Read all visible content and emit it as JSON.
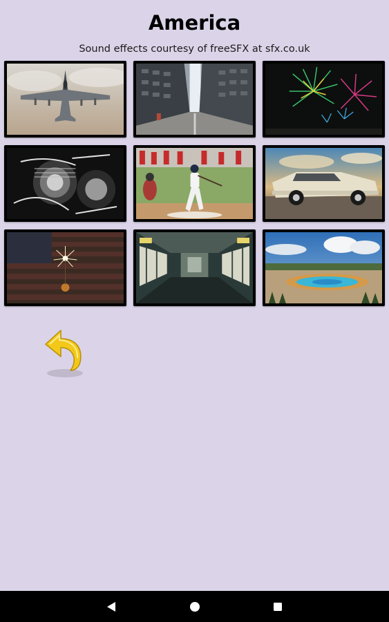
{
  "header": {
    "title": "America",
    "subtitle": "Sound effects courtesy of freeSFX at sfx.co.uk"
  },
  "tiles": [
    {
      "icon": "fighter-jet-image"
    },
    {
      "icon": "city-street-image"
    },
    {
      "icon": "fireworks-image"
    },
    {
      "icon": "motorcycle-engine-image"
    },
    {
      "icon": "baseball-batter-image"
    },
    {
      "icon": "classic-car-image"
    },
    {
      "icon": "sparkler-flag-image"
    },
    {
      "icon": "subway-train-image"
    },
    {
      "icon": "hot-spring-landscape-image"
    }
  ],
  "back_button": {
    "icon": "back-arrow-icon",
    "color": "#f2c81a"
  },
  "navbar": {
    "icons": [
      "nav-back-icon",
      "nav-home-icon",
      "nav-recents-icon"
    ]
  },
  "colors": {
    "background": "#dbd3e8",
    "navbar": "#000000",
    "tile_border": "#000000"
  }
}
